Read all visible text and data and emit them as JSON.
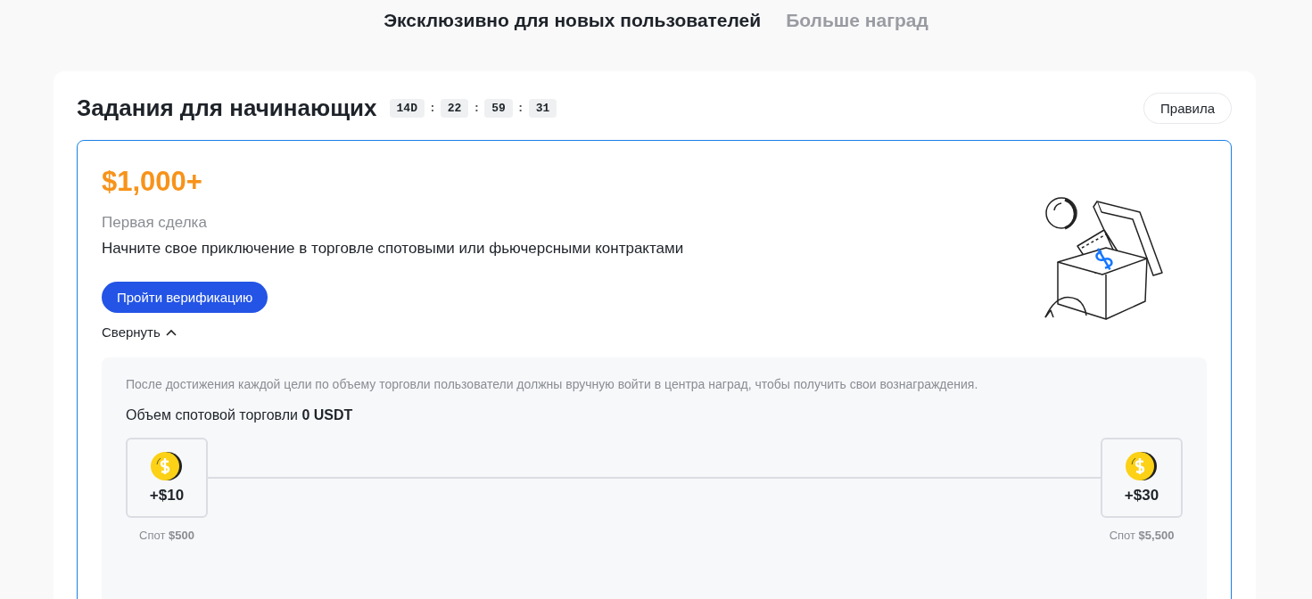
{
  "tabs": [
    {
      "label": "Эксклюзивно для новых пользователей",
      "selected": true
    },
    {
      "label": "Больше наград",
      "selected": false
    }
  ],
  "section": {
    "title": "Задания для начинающих",
    "timer": [
      "14D",
      ":",
      "22",
      ":",
      "59",
      ":",
      "31"
    ],
    "rules_button": "Правила"
  },
  "task": {
    "amount": "$1,000+",
    "name": "Первая сделка",
    "description": "Начните свое приключение в торговле спотовыми или фьючерсными контрактами",
    "action_button": "Пройти верификацию",
    "collapse_link": "Свернуть",
    "expanded": true,
    "details": {
      "note": "После достижения каждой цели по объему торговли пользователи должны вручную войти в центра наград, чтобы получить свои вознаграждения.",
      "volume": "Объем спотовой торговли **0 USDT**",
      "milestones": [
        {
          "reward": "+$10",
          "label": "Спот **$500**"
        },
        {
          "reward": "+$30",
          "label": "Спот **$5,500**"
        }
      ]
    }
  }
}
